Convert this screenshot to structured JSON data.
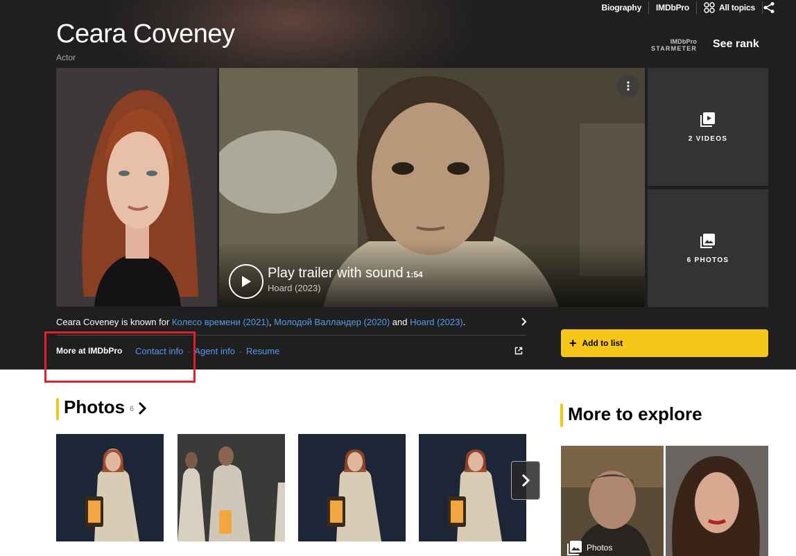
{
  "topnav": {
    "items": [
      "Biography",
      "IMDbPro",
      "All topics"
    ]
  },
  "person": {
    "name": "Ceara Coveney",
    "role": "Actor"
  },
  "starmeter": {
    "pro_label": "IMDbPro",
    "label": "STARMETER",
    "rank_link": "See rank"
  },
  "trailer": {
    "label": "Play trailer with sound",
    "duration": "1:54",
    "title": "Hoard (2023)"
  },
  "media_tiles": {
    "videos_label": "2 VIDEOS",
    "photos_label": "6 PHOTOS"
  },
  "known_for": {
    "prefix": "Ceara Coveney is known for ",
    "titles": [
      "Колесо времени (2021)",
      "Молодой Валландер (2020)",
      "Hoard (2023)"
    ],
    "sep": ", ",
    "and": " and ",
    "end": "."
  },
  "imdbpro": {
    "label": "More at IMDbPro",
    "links": [
      "Contact info",
      "Agent info",
      "Resume"
    ],
    "dot": "·"
  },
  "add_to_list": {
    "label": "Add to list"
  },
  "photos_section": {
    "title": "Photos",
    "count": "6"
  },
  "explore_section": {
    "title": "More to explore",
    "photos_label": "Photos"
  },
  "colors": {
    "accent": "#f5c518",
    "link": "#5799ef",
    "hero_bg": "#1f1f1f",
    "highlight": "#e0202a"
  }
}
